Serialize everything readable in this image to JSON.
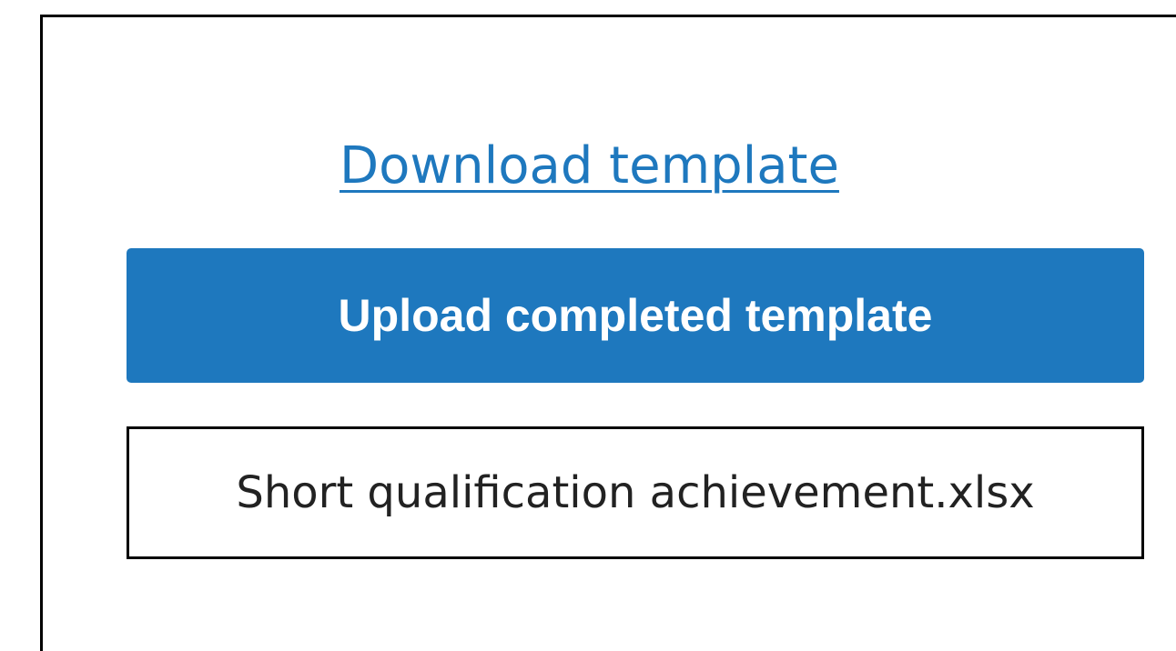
{
  "download": {
    "label": "Download template"
  },
  "upload": {
    "label": "Upload completed template"
  },
  "file": {
    "name": "Short qualification achievement.xlsx"
  },
  "colors": {
    "accent": "#1e78be",
    "text": "#222222",
    "border": "#000000"
  }
}
